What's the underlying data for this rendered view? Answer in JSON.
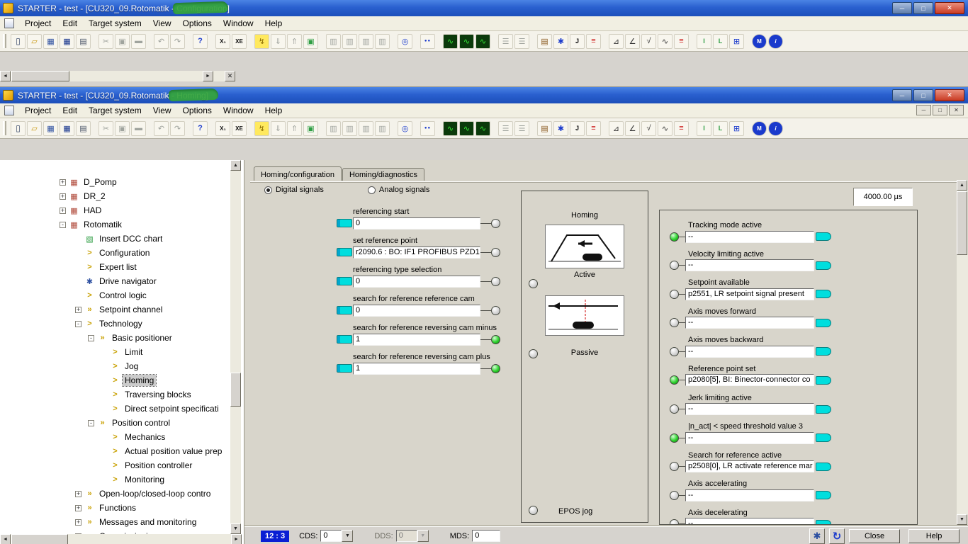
{
  "colors": {
    "titlebar_light": "#4b84e4",
    "titlebar_dark": "#1c4fba",
    "accent_cyan": "#00dede",
    "led_green": "#2ed12e",
    "statusbar_blue": "#0a1fd4",
    "redaction_green": "#35a53c"
  },
  "controls": {
    "minimize": "─",
    "maximize": "□",
    "close": "✕"
  },
  "windows": {
    "top": {
      "title": "STARTER - test - [CU320_09.Rotomatik - Configuration]"
    },
    "main": {
      "title": "STARTER - test - [CU320_09.Rotomatik - Homing]"
    }
  },
  "menu": {
    "items": [
      "Project",
      "Edit",
      "Target system",
      "View",
      "Options",
      "Window",
      "Help"
    ]
  },
  "toolbar": {
    "icons": [
      {
        "name": "new-document-icon",
        "g": "▯",
        "st": "color:#3a4a6b;font-size:12px"
      },
      {
        "name": "open-project-icon",
        "g": "▱",
        "st": "color:#c8960c"
      },
      {
        "name": "save-icon",
        "g": "▦",
        "st": "color:#2c4fa0"
      },
      {
        "name": "save-compile-icon",
        "g": "▦",
        "st": "color:#16348c"
      },
      {
        "name": "print-icon",
        "g": "▤",
        "st": "color:#4a5568"
      },
      {
        "name": "cut-icon",
        "g": "✂",
        "st": "color:#a0a49e",
        "sep": "1"
      },
      {
        "name": "copy-icon",
        "g": "▣",
        "st": "color:#a0a49e"
      },
      {
        "name": "paste-icon",
        "g": "▬",
        "st": "color:#a0a49e"
      },
      {
        "name": "undo-icon",
        "g": "↶",
        "st": "color:#a0a49e",
        "sep": "1"
      },
      {
        "name": "redo-icon",
        "g": "↷",
        "st": "color:#a0a49e"
      },
      {
        "name": "help-pointer-icon",
        "g": "?",
        "st": "color:#1a3acc;font-weight:bold",
        "sep": "1"
      },
      {
        "name": "insert-single-drive-icon",
        "g": "X₁",
        "st": "color:#111;font-size:8px;font-weight:bold",
        "sep": "1"
      },
      {
        "name": "insert-drive-object-icon",
        "g": "XE",
        "st": "color:#111;font-size:8px;font-weight:bold"
      },
      {
        "name": "connect-target-icon",
        "g": "↯",
        "st": "color:#8a6a00;background:#ffe95e",
        "sep": "1"
      },
      {
        "name": "download-to-target-icon",
        "g": "⇓",
        "st": "color:#a0a49e"
      },
      {
        "name": "upload-from-target-icon",
        "g": "⇑",
        "st": "color:#a0a49e"
      },
      {
        "name": "online-mode-icon",
        "g": "▣",
        "st": "color:#2f9e44"
      },
      {
        "name": "drive-function-1-icon",
        "g": "▥",
        "st": "color:#a0a49e",
        "sep": "1"
      },
      {
        "name": "drive-function-2-icon",
        "g": "▥",
        "st": "color:#a0a49e"
      },
      {
        "name": "drive-function-3-icon",
        "g": "▥",
        "st": "color:#a0a49e"
      },
      {
        "name": "drive-function-4-icon",
        "g": "▥",
        "st": "color:#a0a49e"
      },
      {
        "name": "accessible-nodes-icon",
        "g": "◎",
        "st": "color:#1a3acc",
        "sep": "1"
      },
      {
        "name": "target-partners-icon",
        "g": "●●",
        "st": "color:#1a3acc;font-size:6px;letter-spacing:1px",
        "sep": "1"
      },
      {
        "name": "trace-1-icon",
        "g": "∿",
        "st": "color:#36e636;background:#0b3a0b",
        "sep": "1"
      },
      {
        "name": "trace-2-icon",
        "g": "∿",
        "st": "color:#36e636;background:#0b3a0b"
      },
      {
        "name": "trace-3-icon",
        "g": "∿",
        "st": "color:#36e636;background:#0b3a0b"
      },
      {
        "name": "topology-1-icon",
        "g": "☰",
        "st": "color:#a0a49e",
        "sep": "1"
      },
      {
        "name": "topology-2-icon",
        "g": "☰",
        "st": "color:#a0a49e"
      },
      {
        "name": "diagnostics-icon",
        "g": "▤",
        "st": "color:#8a5a20",
        "sep": "1"
      },
      {
        "name": "configuration-gear-icon",
        "g": "✱",
        "st": "color:#1a3acc"
      },
      {
        "name": "jog-icon",
        "g": "J",
        "st": "color:#111;font-weight:bold;font-size:9px"
      },
      {
        "name": "limit-lines-icon",
        "g": "≡",
        "st": "color:#cc2020"
      },
      {
        "name": "profile-curve-icon",
        "g": "⊿",
        "st": "color:#333",
        "sep": "1"
      },
      {
        "name": "ramp-curve-icon",
        "g": "∠",
        "st": "color:#333"
      },
      {
        "name": "root-curve-icon",
        "g": "√",
        "st": "color:#333"
      },
      {
        "name": "wave-curve-icon",
        "g": "∿",
        "st": "color:#333"
      },
      {
        "name": "limit-lines-2-icon",
        "g": "≡",
        "st": "color:#cc2020"
      },
      {
        "name": "interconnect-in-icon",
        "g": "I",
        "st": "color:#2f9e44;font-weight:bold;font-size:9px",
        "sep": "1"
      },
      {
        "name": "interconnect-out-icon",
        "g": "L",
        "st": "color:#2f9e44;font-weight:bold;font-size:9px"
      },
      {
        "name": "grid-view-icon",
        "g": "⊞",
        "st": "color:#1a3acc"
      },
      {
        "name": "motor-module-icon",
        "g": "M",
        "st": "color:#fff;background:#1a3acc;border-radius:50%;font-size:8px;font-weight:bold",
        "sep": "1"
      },
      {
        "name": "info-icon",
        "g": "i",
        "st": "color:#fff;background:#1a3acc;border-radius:50%;font-size:8px;font-weight:bold;font-style:italic"
      }
    ]
  },
  "tree": {
    "items": [
      {
        "level": "0",
        "exp": "+",
        "icon": "drive",
        "label": "D_Pomp"
      },
      {
        "level": "0",
        "exp": "+",
        "icon": "drive",
        "label": "DR_2"
      },
      {
        "level": "0",
        "exp": "+",
        "icon": "drive",
        "label": "HAD"
      },
      {
        "level": "0",
        "exp": "-",
        "icon": "drive",
        "label": "Rotomatik"
      },
      {
        "level": "1",
        "exp": "",
        "icon": "chart",
        "label": "Insert DCC chart"
      },
      {
        "level": "1",
        "exp": "",
        "icon": "arrow",
        "label": "Configuration"
      },
      {
        "level": "1",
        "exp": "",
        "icon": "arrow",
        "label": "Expert list"
      },
      {
        "level": "1",
        "exp": "",
        "icon": "gear",
        "label": "Drive navigator"
      },
      {
        "level": "1",
        "exp": "",
        "icon": "arrow",
        "label": "Control logic"
      },
      {
        "level": "1",
        "exp": "+",
        "icon": "arrow2",
        "label": "Setpoint channel"
      },
      {
        "level": "1",
        "exp": "-",
        "icon": "arrow",
        "label": "Technology"
      },
      {
        "level": "2",
        "exp": "-",
        "icon": "arrow2",
        "label": "Basic positioner"
      },
      {
        "level": "3",
        "exp": "",
        "icon": "arrow",
        "label": "Limit"
      },
      {
        "level": "3",
        "exp": "",
        "icon": "arrow",
        "label": "Jog"
      },
      {
        "level": "3",
        "exp": "",
        "icon": "arrow",
        "label": "Homing",
        "sel": "1"
      },
      {
        "level": "3",
        "exp": "",
        "icon": "arrow",
        "label": "Traversing blocks"
      },
      {
        "level": "3",
        "exp": "",
        "icon": "arrow",
        "label": "Direct setpoint specificati"
      },
      {
        "level": "2",
        "exp": "-",
        "icon": "arrow2",
        "label": "Position control"
      },
      {
        "level": "3",
        "exp": "",
        "icon": "arrow",
        "label": "Mechanics"
      },
      {
        "level": "3",
        "exp": "",
        "icon": "arrow",
        "label": "Actual position value prep"
      },
      {
        "level": "3",
        "exp": "",
        "icon": "arrow",
        "label": "Position controller"
      },
      {
        "level": "3",
        "exp": "",
        "icon": "arrow",
        "label": "Monitoring"
      },
      {
        "level": "1",
        "exp": "+",
        "icon": "arrow2",
        "label": "Open-loop/closed-loop contro"
      },
      {
        "level": "1",
        "exp": "+",
        "icon": "arrow2",
        "label": "Functions"
      },
      {
        "level": "1",
        "exp": "+",
        "icon": "arrow2",
        "label": "Messages and monitoring"
      },
      {
        "level": "1",
        "exp": "+",
        "icon": "arrow2",
        "label": "Commissioning"
      }
    ]
  },
  "panel": {
    "tabs": [
      {
        "label": "Homing/configuration",
        "active": "1"
      },
      {
        "label": "Homing/diagnostics"
      }
    ],
    "radios": [
      {
        "label": "Digital signals",
        "checked": "1"
      },
      {
        "label": "Analog signals"
      }
    ],
    "signals": [
      {
        "label": "referencing start",
        "value": "0",
        "led": "gray"
      },
      {
        "label": "set reference point",
        "value": "r2090.6 : BO: IF1 PROFIBUS PZD1",
        "led": "gray"
      },
      {
        "label": "referencing type selection",
        "value": "0",
        "led": "gray"
      },
      {
        "label": "search for reference reference cam",
        "value": "0",
        "led": "gray"
      },
      {
        "label": "search for reference reversing cam minus",
        "value": "1",
        "led": "green"
      },
      {
        "label": "search for reference reversing cam plus",
        "value": "1",
        "led": "green"
      }
    ],
    "homing": {
      "title": "Homing",
      "active_label": "Active",
      "passive_label": "Passive",
      "epos_label": "EPOS jog"
    },
    "sampling_time": "4000.00 µs",
    "status": [
      {
        "label": "Tracking mode active",
        "value": "--",
        "led": "green"
      },
      {
        "label": "Velocity limiting active",
        "value": "--",
        "led": "gray"
      },
      {
        "label": "Setpoint available",
        "value": "p2551, LR setpoint signal present",
        "led": "gray"
      },
      {
        "label": "Axis moves forward",
        "value": "--",
        "led": "gray"
      },
      {
        "label": "Axis moves backward",
        "value": "--",
        "led": "gray"
      },
      {
        "label": "Reference point set",
        "value": "p2080[5], BI: Binector-connector co",
        "led": "green"
      },
      {
        "label": "Jerk limiting active",
        "value": "--",
        "led": "gray"
      },
      {
        "label": "|n_act| < speed threshold value 3",
        "value": "--",
        "led": "green"
      },
      {
        "label": "Search for reference active",
        "value": "p2508[0], LR activate reference mar",
        "led": "gray"
      },
      {
        "label": "Axis accelerating",
        "value": "--",
        "led": "gray"
      },
      {
        "label": "Axis decelerating",
        "value": "--",
        "led": "gray"
      }
    ]
  },
  "statusbar": {
    "ds": "12 : 3",
    "cds_label": "CDS:",
    "cds_value": "0",
    "dds_label": "DDS:",
    "dds_value": "0",
    "mds_label": "MDS:",
    "mds_value": "0",
    "close": "Close",
    "help": "Help"
  }
}
